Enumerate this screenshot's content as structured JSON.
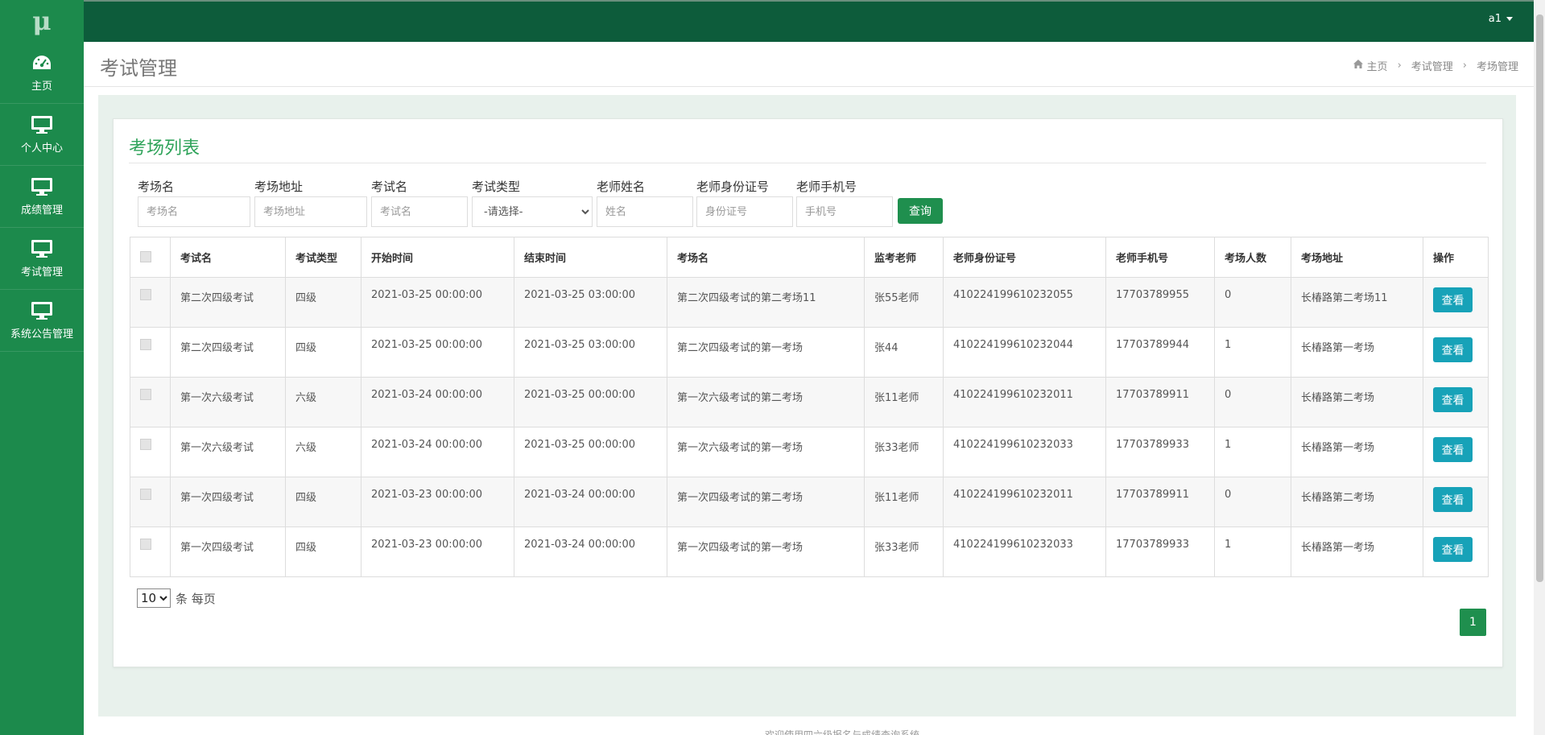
{
  "app": {
    "logo": "μ"
  },
  "sidebar": {
    "items": [
      {
        "label": "主页",
        "icon": "dashboard-icon"
      },
      {
        "label": "个人中心",
        "icon": "monitor-icon"
      },
      {
        "label": "成绩管理",
        "icon": "monitor-icon"
      },
      {
        "label": "考试管理",
        "icon": "monitor-icon"
      },
      {
        "label": "系统公告管理",
        "icon": "monitor-icon"
      }
    ]
  },
  "topbar": {
    "username": "a1"
  },
  "header": {
    "title": "考试管理",
    "breadcrumb": [
      "主页",
      "考试管理",
      "考场管理"
    ]
  },
  "panel": {
    "title": "考场列表"
  },
  "filters": {
    "exam_room_name": {
      "label": "考场名",
      "placeholder": "考场名"
    },
    "exam_room_address": {
      "label": "考场地址",
      "placeholder": "考场地址"
    },
    "exam_name": {
      "label": "考试名",
      "placeholder": "考试名"
    },
    "exam_type": {
      "label": "考试类型",
      "selected": "-请选择-"
    },
    "teacher_name": {
      "label": "老师姓名",
      "placeholder": "姓名"
    },
    "teacher_id": {
      "label": "老师身份证号",
      "placeholder": "身份证号"
    },
    "teacher_phone": {
      "label": "老师手机号",
      "placeholder": "手机号"
    },
    "query_label": "查询"
  },
  "table": {
    "columns": [
      "考试名",
      "考试类型",
      "开始时间",
      "结束时间",
      "考场名",
      "监考老师",
      "老师身份证号",
      "老师手机号",
      "考场人数",
      "考场地址",
      "操作"
    ],
    "action_label": "查看",
    "rows": [
      [
        "第二次四级考试",
        "四级",
        "2021-03-25 00:00:00",
        "2021-03-25 03:00:00",
        "第二次四级考试的第二考场11",
        "张55老师",
        "410224199610232055",
        "17703789955",
        "0",
        "长椿路第二考场11"
      ],
      [
        "第二次四级考试",
        "四级",
        "2021-03-25 00:00:00",
        "2021-03-25 03:00:00",
        "第二次四级考试的第一考场",
        "张44",
        "410224199610232044",
        "17703789944",
        "1",
        "长椿路第一考场"
      ],
      [
        "第一次六级考试",
        "六级",
        "2021-03-24 00:00:00",
        "2021-03-25 00:00:00",
        "第一次六级考试的第二考场",
        "张11老师",
        "410224199610232011",
        "17703789911",
        "0",
        "长椿路第二考场"
      ],
      [
        "第一次六级考试",
        "六级",
        "2021-03-24 00:00:00",
        "2021-03-25 00:00:00",
        "第一次六级考试的第一考场",
        "张33老师",
        "410224199610232033",
        "17703789933",
        "1",
        "长椿路第一考场"
      ],
      [
        "第一次四级考试",
        "四级",
        "2021-03-23 00:00:00",
        "2021-03-24 00:00:00",
        "第一次四级考试的第二考场",
        "张11老师",
        "410224199610232011",
        "17703789911",
        "0",
        "长椿路第二考场"
      ],
      [
        "第一次四级考试",
        "四级",
        "2021-03-23 00:00:00",
        "2021-03-24 00:00:00",
        "第一次四级考试的第一考场",
        "张33老师",
        "410224199610232033",
        "17703789933",
        "1",
        "长椿路第一考场"
      ]
    ]
  },
  "pagination": {
    "page_size": "10",
    "page_size_suffix": "条 每页",
    "current_page": "1"
  },
  "footer": {
    "text": "欢迎使用四六级报名与成绩查询系统"
  },
  "colors": {
    "sidebar": "#1c8a4c",
    "topbar": "#0d5c3b",
    "accent": "#2fa35a",
    "view_button": "#17a2b8"
  }
}
